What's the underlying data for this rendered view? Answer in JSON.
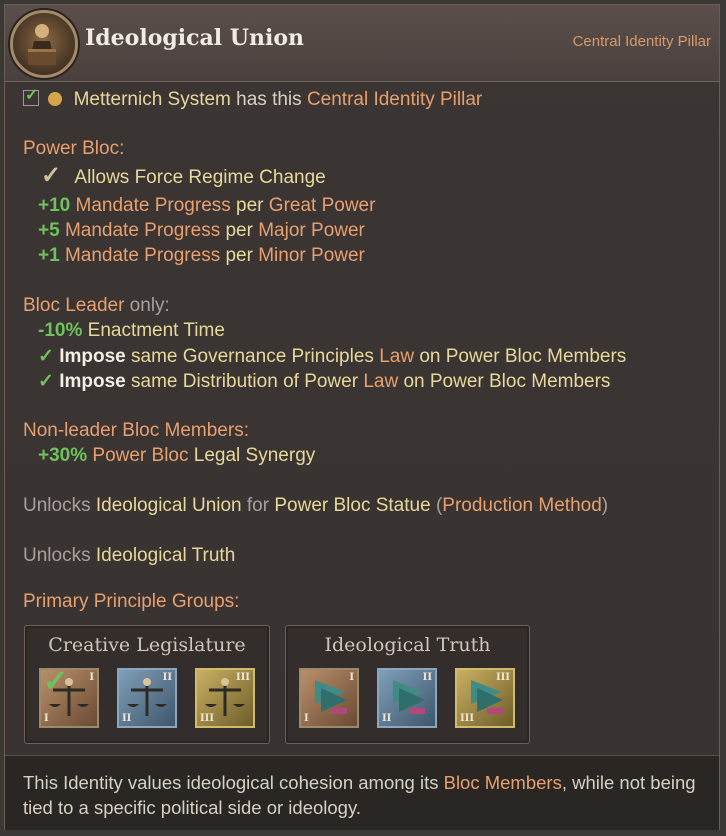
{
  "header": {
    "title": "Ideological Union",
    "subtitle": "Central Identity Pillar"
  },
  "owner_line": {
    "name": "Metternich System",
    "mid": " has this ",
    "pillar": "Central Identity Pillar"
  },
  "power_bloc": {
    "heading": "Power Bloc:",
    "allows": "Allows Force Regime Change",
    "mandates": [
      {
        "value": "+10",
        "a": "Mandate Progress",
        "per": " per ",
        "b": "Great Power"
      },
      {
        "value": "+5",
        "a": "Mandate Progress",
        "per": " per ",
        "b": "Major Power"
      },
      {
        "value": "+1",
        "a": "Mandate Progress",
        "per": " per ",
        "b": "Minor Power"
      }
    ]
  },
  "leader": {
    "heading": "Bloc Leader",
    "only": " only:",
    "enact_value": "-10%",
    "enact_label": "Enactment Time",
    "imposes": [
      {
        "impose": "Impose",
        "rest": " same Governance Principles ",
        "law": "Law",
        "tail": " on Power Bloc Members"
      },
      {
        "impose": "Impose",
        "rest": " same Distribution of Power ",
        "law": "Law",
        "tail": " on Power Bloc Members"
      }
    ]
  },
  "members": {
    "heading": "Non-leader Bloc Members:",
    "value": "+30%",
    "a": "Power Bloc",
    "b": " Legal Synergy"
  },
  "unlocks1": {
    "prefix": "Unlocks ",
    "item": "Ideological Union",
    "for": " for ",
    "building": "Power Bloc Statue",
    "open": " (",
    "pm": "Production Method",
    "close": ")"
  },
  "unlocks2": {
    "prefix": "Unlocks ",
    "item": "Ideological Truth"
  },
  "principles": {
    "heading": "Primary Principle Groups:",
    "groups": [
      {
        "title": "Creative Legislature",
        "tiers": [
          "I",
          "II",
          "III"
        ],
        "icon": "scales-icon"
      },
      {
        "title": "Ideological Truth",
        "tiers": [
          "I",
          "II",
          "III"
        ],
        "icon": "flag-icon"
      }
    ]
  },
  "footer": {
    "pre": "This Identity values ideological cohesion among its ",
    "link": "Bloc Members",
    "post": ", while not being tied to a specific political side or ideology."
  },
  "colors": {
    "orange": "#e8a06f",
    "yellow": "#e8d89a",
    "green": "#6fc25c"
  }
}
